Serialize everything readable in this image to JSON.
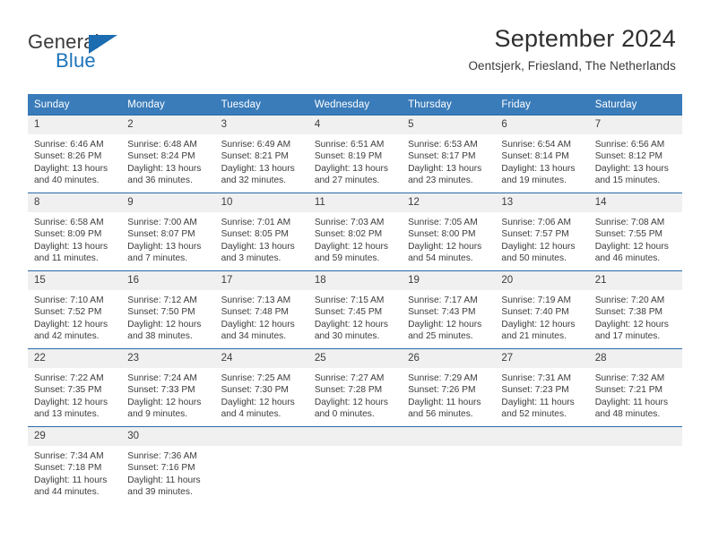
{
  "brand": {
    "name_top": "General",
    "name_bottom": "Blue",
    "color_dark": "#3a3a3a",
    "color_blue": "#1b74bb"
  },
  "header": {
    "title": "September 2024",
    "subtitle": "Oentsjerk, Friesland, The Netherlands"
  },
  "theme": {
    "header_bg": "#3a7cba",
    "week_border": "#2a6ba8",
    "daynum_bg": "#f0f0f0",
    "text": "#3c3c3c"
  },
  "weekdays": [
    "Sunday",
    "Monday",
    "Tuesday",
    "Wednesday",
    "Thursday",
    "Friday",
    "Saturday"
  ],
  "weeks": [
    [
      {
        "day": "1",
        "sunrise": "Sunrise: 6:46 AM",
        "sunset": "Sunset: 8:26 PM",
        "daylight1": "Daylight: 13 hours",
        "daylight2": "and 40 minutes."
      },
      {
        "day": "2",
        "sunrise": "Sunrise: 6:48 AM",
        "sunset": "Sunset: 8:24 PM",
        "daylight1": "Daylight: 13 hours",
        "daylight2": "and 36 minutes."
      },
      {
        "day": "3",
        "sunrise": "Sunrise: 6:49 AM",
        "sunset": "Sunset: 8:21 PM",
        "daylight1": "Daylight: 13 hours",
        "daylight2": "and 32 minutes."
      },
      {
        "day": "4",
        "sunrise": "Sunrise: 6:51 AM",
        "sunset": "Sunset: 8:19 PM",
        "daylight1": "Daylight: 13 hours",
        "daylight2": "and 27 minutes."
      },
      {
        "day": "5",
        "sunrise": "Sunrise: 6:53 AM",
        "sunset": "Sunset: 8:17 PM",
        "daylight1": "Daylight: 13 hours",
        "daylight2": "and 23 minutes."
      },
      {
        "day": "6",
        "sunrise": "Sunrise: 6:54 AM",
        "sunset": "Sunset: 8:14 PM",
        "daylight1": "Daylight: 13 hours",
        "daylight2": "and 19 minutes."
      },
      {
        "day": "7",
        "sunrise": "Sunrise: 6:56 AM",
        "sunset": "Sunset: 8:12 PM",
        "daylight1": "Daylight: 13 hours",
        "daylight2": "and 15 minutes."
      }
    ],
    [
      {
        "day": "8",
        "sunrise": "Sunrise: 6:58 AM",
        "sunset": "Sunset: 8:09 PM",
        "daylight1": "Daylight: 13 hours",
        "daylight2": "and 11 minutes."
      },
      {
        "day": "9",
        "sunrise": "Sunrise: 7:00 AM",
        "sunset": "Sunset: 8:07 PM",
        "daylight1": "Daylight: 13 hours",
        "daylight2": "and 7 minutes."
      },
      {
        "day": "10",
        "sunrise": "Sunrise: 7:01 AM",
        "sunset": "Sunset: 8:05 PM",
        "daylight1": "Daylight: 13 hours",
        "daylight2": "and 3 minutes."
      },
      {
        "day": "11",
        "sunrise": "Sunrise: 7:03 AM",
        "sunset": "Sunset: 8:02 PM",
        "daylight1": "Daylight: 12 hours",
        "daylight2": "and 59 minutes."
      },
      {
        "day": "12",
        "sunrise": "Sunrise: 7:05 AM",
        "sunset": "Sunset: 8:00 PM",
        "daylight1": "Daylight: 12 hours",
        "daylight2": "and 54 minutes."
      },
      {
        "day": "13",
        "sunrise": "Sunrise: 7:06 AM",
        "sunset": "Sunset: 7:57 PM",
        "daylight1": "Daylight: 12 hours",
        "daylight2": "and 50 minutes."
      },
      {
        "day": "14",
        "sunrise": "Sunrise: 7:08 AM",
        "sunset": "Sunset: 7:55 PM",
        "daylight1": "Daylight: 12 hours",
        "daylight2": "and 46 minutes."
      }
    ],
    [
      {
        "day": "15",
        "sunrise": "Sunrise: 7:10 AM",
        "sunset": "Sunset: 7:52 PM",
        "daylight1": "Daylight: 12 hours",
        "daylight2": "and 42 minutes."
      },
      {
        "day": "16",
        "sunrise": "Sunrise: 7:12 AM",
        "sunset": "Sunset: 7:50 PM",
        "daylight1": "Daylight: 12 hours",
        "daylight2": "and 38 minutes."
      },
      {
        "day": "17",
        "sunrise": "Sunrise: 7:13 AM",
        "sunset": "Sunset: 7:48 PM",
        "daylight1": "Daylight: 12 hours",
        "daylight2": "and 34 minutes."
      },
      {
        "day": "18",
        "sunrise": "Sunrise: 7:15 AM",
        "sunset": "Sunset: 7:45 PM",
        "daylight1": "Daylight: 12 hours",
        "daylight2": "and 30 minutes."
      },
      {
        "day": "19",
        "sunrise": "Sunrise: 7:17 AM",
        "sunset": "Sunset: 7:43 PM",
        "daylight1": "Daylight: 12 hours",
        "daylight2": "and 25 minutes."
      },
      {
        "day": "20",
        "sunrise": "Sunrise: 7:19 AM",
        "sunset": "Sunset: 7:40 PM",
        "daylight1": "Daylight: 12 hours",
        "daylight2": "and 21 minutes."
      },
      {
        "day": "21",
        "sunrise": "Sunrise: 7:20 AM",
        "sunset": "Sunset: 7:38 PM",
        "daylight1": "Daylight: 12 hours",
        "daylight2": "and 17 minutes."
      }
    ],
    [
      {
        "day": "22",
        "sunrise": "Sunrise: 7:22 AM",
        "sunset": "Sunset: 7:35 PM",
        "daylight1": "Daylight: 12 hours",
        "daylight2": "and 13 minutes."
      },
      {
        "day": "23",
        "sunrise": "Sunrise: 7:24 AM",
        "sunset": "Sunset: 7:33 PM",
        "daylight1": "Daylight: 12 hours",
        "daylight2": "and 9 minutes."
      },
      {
        "day": "24",
        "sunrise": "Sunrise: 7:25 AM",
        "sunset": "Sunset: 7:30 PM",
        "daylight1": "Daylight: 12 hours",
        "daylight2": "and 4 minutes."
      },
      {
        "day": "25",
        "sunrise": "Sunrise: 7:27 AM",
        "sunset": "Sunset: 7:28 PM",
        "daylight1": "Daylight: 12 hours",
        "daylight2": "and 0 minutes."
      },
      {
        "day": "26",
        "sunrise": "Sunrise: 7:29 AM",
        "sunset": "Sunset: 7:26 PM",
        "daylight1": "Daylight: 11 hours",
        "daylight2": "and 56 minutes."
      },
      {
        "day": "27",
        "sunrise": "Sunrise: 7:31 AM",
        "sunset": "Sunset: 7:23 PM",
        "daylight1": "Daylight: 11 hours",
        "daylight2": "and 52 minutes."
      },
      {
        "day": "28",
        "sunrise": "Sunrise: 7:32 AM",
        "sunset": "Sunset: 7:21 PM",
        "daylight1": "Daylight: 11 hours",
        "daylight2": "and 48 minutes."
      }
    ],
    [
      {
        "day": "29",
        "sunrise": "Sunrise: 7:34 AM",
        "sunset": "Sunset: 7:18 PM",
        "daylight1": "Daylight: 11 hours",
        "daylight2": "and 44 minutes."
      },
      {
        "day": "30",
        "sunrise": "Sunrise: 7:36 AM",
        "sunset": "Sunset: 7:16 PM",
        "daylight1": "Daylight: 11 hours",
        "daylight2": "and 39 minutes."
      },
      {
        "day": "",
        "sunrise": "",
        "sunset": "",
        "daylight1": "",
        "daylight2": ""
      },
      {
        "day": "",
        "sunrise": "",
        "sunset": "",
        "daylight1": "",
        "daylight2": ""
      },
      {
        "day": "",
        "sunrise": "",
        "sunset": "",
        "daylight1": "",
        "daylight2": ""
      },
      {
        "day": "",
        "sunrise": "",
        "sunset": "",
        "daylight1": "",
        "daylight2": ""
      },
      {
        "day": "",
        "sunrise": "",
        "sunset": "",
        "daylight1": "",
        "daylight2": ""
      }
    ]
  ]
}
